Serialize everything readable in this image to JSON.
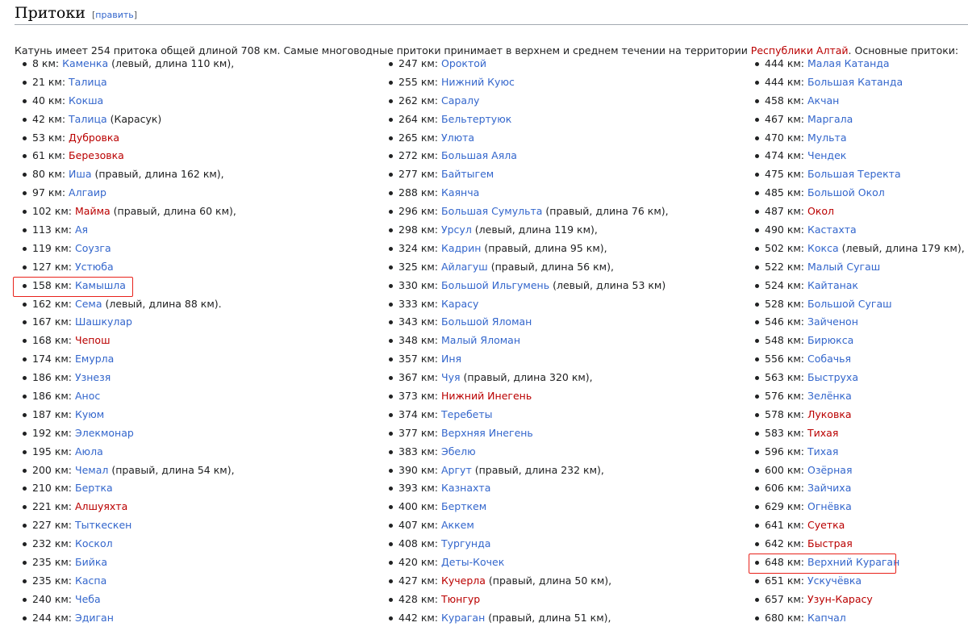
{
  "heading": {
    "title": "Притоки",
    "edit_open": "[",
    "edit_label": "править",
    "edit_close": "]"
  },
  "intro": {
    "before_link": "Катунь имеет 254 притока общей длиной 708 км. Самые многоводные притоки принимает в верхнем и среднем течении на территории ",
    "link": "Республики Алтай",
    "after_link": ". Основные притоки:"
  },
  "colors": {
    "link": "#3366cc",
    "redlink": "#ba0000",
    "marker": "#e8221b"
  },
  "columns": [
    [
      {
        "km": "8 км: ",
        "name": "Каменка",
        "red": false,
        "note": " (левый, длина 110 км),"
      },
      {
        "km": "21 км: ",
        "name": "Талица",
        "red": false,
        "note": ""
      },
      {
        "km": "40 км: ",
        "name": "Кокша",
        "red": false,
        "note": ""
      },
      {
        "km": "42 км: ",
        "name": "Талица",
        "red": false,
        "note": " (Карасук)"
      },
      {
        "km": "53 км: ",
        "name": "Дубровка",
        "red": true,
        "note": ""
      },
      {
        "km": "61 км: ",
        "name": "Березовка",
        "red": true,
        "note": ""
      },
      {
        "km": "80 км: ",
        "name": "Иша",
        "red": false,
        "note": " (правый, длина 162 км),"
      },
      {
        "km": "97 км: ",
        "name": "Алгаир",
        "red": false,
        "note": ""
      },
      {
        "km": "102 км: ",
        "name": "Майма",
        "red": true,
        "note": " (правый, длина 60 км),"
      },
      {
        "km": "113 км: ",
        "name": "Ая",
        "red": false,
        "note": ""
      },
      {
        "km": "119 км: ",
        "name": "Соузга",
        "red": false,
        "note": ""
      },
      {
        "km": "127 км: ",
        "name": "Устюба",
        "red": false,
        "note": ""
      },
      {
        "km": "158 км: ",
        "name": "Камышла",
        "red": false,
        "note": "",
        "marked": true
      },
      {
        "km": "162 км: ",
        "name": "Сема",
        "red": false,
        "note": " (левый, длина 88 км)."
      },
      {
        "km": "167 км: ",
        "name": "Шашкулар",
        "red": false,
        "note": ""
      },
      {
        "km": "168 км: ",
        "name": "Чепош",
        "red": true,
        "note": ""
      },
      {
        "km": "174 км: ",
        "name": "Емурла",
        "red": false,
        "note": ""
      },
      {
        "km": "186 км: ",
        "name": "Узнезя",
        "red": false,
        "note": ""
      },
      {
        "km": "186 км: ",
        "name": "Анос",
        "red": false,
        "note": ""
      },
      {
        "km": "187 км: ",
        "name": "Куюм",
        "red": false,
        "note": ""
      },
      {
        "km": "192 км: ",
        "name": "Элекмонар",
        "red": false,
        "note": ""
      },
      {
        "km": "195 км: ",
        "name": "Аюла",
        "red": false,
        "note": ""
      },
      {
        "km": "200 км: ",
        "name": "Чемал",
        "red": false,
        "note": " (правый, длина 54 км),"
      },
      {
        "km": "210 км: ",
        "name": "Бертка",
        "red": false,
        "note": ""
      },
      {
        "km": "221 км: ",
        "name": "Алшуяхта",
        "red": true,
        "note": ""
      },
      {
        "km": "227 км: ",
        "name": "Тыткескен",
        "red": false,
        "note": ""
      },
      {
        "km": "232 км: ",
        "name": "Коскол",
        "red": false,
        "note": ""
      },
      {
        "km": "235 км: ",
        "name": "Бийка",
        "red": false,
        "note": ""
      },
      {
        "km": "235 км: ",
        "name": "Каспа",
        "red": false,
        "note": ""
      },
      {
        "km": "240 км: ",
        "name": "Чеба",
        "red": false,
        "note": ""
      },
      {
        "km": "244 км: ",
        "name": "Эдиган",
        "red": false,
        "note": ""
      }
    ],
    [
      {
        "km": "247 км: ",
        "name": "Ороктой",
        "red": false,
        "note": ""
      },
      {
        "km": "255 км: ",
        "name": "Нижний Куюс",
        "red": false,
        "note": ""
      },
      {
        "km": "262 км: ",
        "name": "Саралу",
        "red": false,
        "note": ""
      },
      {
        "km": "264 км: ",
        "name": "Бельтертуюк",
        "red": false,
        "note": ""
      },
      {
        "km": "265 км: ",
        "name": "Улюта",
        "red": false,
        "note": ""
      },
      {
        "km": "272 км: ",
        "name": "Большая Аяла",
        "red": false,
        "note": ""
      },
      {
        "km": "277 км: ",
        "name": "Байтыгем",
        "red": false,
        "note": ""
      },
      {
        "km": "288 км: ",
        "name": "Каянча",
        "red": false,
        "note": ""
      },
      {
        "km": "296 км: ",
        "name": "Большая Сумульта",
        "red": false,
        "note": " (правый, длина 76 км),"
      },
      {
        "km": "298 км: ",
        "name": "Урсул",
        "red": false,
        "note": " (левый, длина 119 км),"
      },
      {
        "km": "324 км: ",
        "name": "Кадрин",
        "red": false,
        "note": " (правый, длина 95 км),"
      },
      {
        "km": "325 км: ",
        "name": "Айлагуш",
        "red": false,
        "note": " (правый, длина 56 км),"
      },
      {
        "km": "330 км: ",
        "name": "Большой Ильгумень",
        "red": false,
        "note": " (левый, длина 53 км)"
      },
      {
        "km": "333 км: ",
        "name": "Карасу",
        "red": false,
        "note": ""
      },
      {
        "km": "343 км: ",
        "name": "Большой Яломан",
        "red": false,
        "note": ""
      },
      {
        "km": "348 км: ",
        "name": "Малый Яломан",
        "red": false,
        "note": ""
      },
      {
        "km": "357 км: ",
        "name": "Иня",
        "red": false,
        "note": ""
      },
      {
        "km": "367 км: ",
        "name": "Чуя",
        "red": false,
        "note": " (правый, длина 320 км),"
      },
      {
        "km": "373 км: ",
        "name": "Нижний Инегень",
        "red": true,
        "note": ""
      },
      {
        "km": "374 км: ",
        "name": "Теребеты",
        "red": false,
        "note": ""
      },
      {
        "km": "377 км: ",
        "name": "Верхняя Инегень",
        "red": false,
        "note": ""
      },
      {
        "km": "383 км: ",
        "name": "Эбелю",
        "red": false,
        "note": ""
      },
      {
        "km": "390 км: ",
        "name": "Аргут",
        "red": false,
        "note": " (правый, длина 232 км),"
      },
      {
        "km": "393 км: ",
        "name": "Казнахта",
        "red": false,
        "note": ""
      },
      {
        "km": "400 км: ",
        "name": "Берткем",
        "red": false,
        "note": ""
      },
      {
        "km": "407 км: ",
        "name": "Аккем",
        "red": false,
        "note": ""
      },
      {
        "km": "408 км: ",
        "name": "Тургунда",
        "red": false,
        "note": ""
      },
      {
        "km": "420 км: ",
        "name": "Деты-Кочек",
        "red": false,
        "note": ""
      },
      {
        "km": "427 км: ",
        "name": "Кучерла",
        "red": true,
        "note": " (правый, длина 50 км),"
      },
      {
        "km": "428 км: ",
        "name": "Тюнгур",
        "red": true,
        "note": ""
      },
      {
        "km": "442 км: ",
        "name": "Кураган",
        "red": false,
        "note": " (правый, длина 51 км),"
      }
    ],
    [
      {
        "km": "444 км: ",
        "name": "Малая Катанда",
        "red": false,
        "note": ""
      },
      {
        "km": "444 км: ",
        "name": "Большая Катанда",
        "red": false,
        "note": ""
      },
      {
        "km": "458 км: ",
        "name": "Акчан",
        "red": false,
        "note": ""
      },
      {
        "km": "467 км: ",
        "name": "Маргала",
        "red": false,
        "note": ""
      },
      {
        "km": "470 км: ",
        "name": "Мульта",
        "red": false,
        "note": ""
      },
      {
        "km": "474 км: ",
        "name": "Чендек",
        "red": false,
        "note": ""
      },
      {
        "km": "475 км: ",
        "name": "Большая Теректа",
        "red": false,
        "note": ""
      },
      {
        "km": "485 км: ",
        "name": "Большой Окол",
        "red": false,
        "note": ""
      },
      {
        "km": "487 км: ",
        "name": "Окол",
        "red": true,
        "note": ""
      },
      {
        "km": "490 км: ",
        "name": "Кастахта",
        "red": false,
        "note": ""
      },
      {
        "km": "502 км: ",
        "name": "Кокса",
        "red": false,
        "note": " (левый, длина 179 км),"
      },
      {
        "km": "522 км: ",
        "name": "Малый Сугаш",
        "red": false,
        "note": ""
      },
      {
        "km": "524 км: ",
        "name": "Кайтанак",
        "red": false,
        "note": ""
      },
      {
        "km": "528 км: ",
        "name": "Большой Сугаш",
        "red": false,
        "note": ""
      },
      {
        "km": "546 км: ",
        "name": "Зайченон",
        "red": false,
        "note": ""
      },
      {
        "km": "548 км: ",
        "name": "Бирюкса",
        "red": false,
        "note": ""
      },
      {
        "km": "556 км: ",
        "name": "Собачья",
        "red": false,
        "note": ""
      },
      {
        "km": "563 км: ",
        "name": "Быструха",
        "red": false,
        "note": ""
      },
      {
        "km": "576 км: ",
        "name": "Зелёнка",
        "red": false,
        "note": ""
      },
      {
        "km": "578 км: ",
        "name": "Луковка",
        "red": true,
        "note": ""
      },
      {
        "km": "583 км: ",
        "name": "Тихая",
        "red": true,
        "note": ""
      },
      {
        "km": "596 км: ",
        "name": "Тихая",
        "red": false,
        "note": ""
      },
      {
        "km": "600 км: ",
        "name": "Озёрная",
        "red": false,
        "note": ""
      },
      {
        "km": "606 км: ",
        "name": "Зайчиха",
        "red": false,
        "note": ""
      },
      {
        "km": "629 км: ",
        "name": "Огнёвка",
        "red": false,
        "note": ""
      },
      {
        "km": "641 км: ",
        "name": "Суетка",
        "red": true,
        "note": ""
      },
      {
        "km": "642 км: ",
        "name": "Быстрая",
        "red": true,
        "note": ""
      },
      {
        "km": "648 км: ",
        "name": "Верхний Кураган",
        "red": false,
        "note": "",
        "marked": true
      },
      {
        "km": "651 км: ",
        "name": "Ускучёвка",
        "red": false,
        "note": ""
      },
      {
        "km": "657 км: ",
        "name": "Узун-Карасу",
        "red": true,
        "note": ""
      },
      {
        "km": "680 км: ",
        "name": "Капчал",
        "red": false,
        "note": ""
      }
    ]
  ]
}
